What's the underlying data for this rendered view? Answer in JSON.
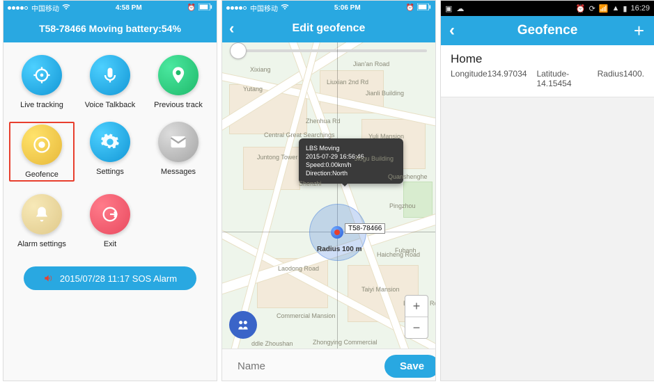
{
  "screen1": {
    "status": {
      "carrier": "中国移动",
      "time": "4:58 PM"
    },
    "title": "T58-78466 Moving battery:54%",
    "items": [
      {
        "label": "Live tracking",
        "icon": "target",
        "color": "c-blue"
      },
      {
        "label": "Voice Talkback",
        "icon": "mic",
        "color": "c-blue2"
      },
      {
        "label": "Previous track",
        "icon": "pin",
        "color": "c-green"
      },
      {
        "label": "Geofence",
        "icon": "record",
        "color": "c-yellow",
        "highlighted": true
      },
      {
        "label": "Settings",
        "icon": "gear",
        "color": "c-blue2"
      },
      {
        "label": "Messages",
        "icon": "mail",
        "color": "c-grey"
      },
      {
        "label": "Alarm settings",
        "icon": "bell",
        "color": "c-beige"
      },
      {
        "label": "Exit",
        "icon": "exit",
        "color": "c-pink"
      }
    ],
    "sos": "2015/07/28 11:17 SOS Alarm"
  },
  "screen2": {
    "status": {
      "carrier": "中国移动",
      "time": "5:06 PM"
    },
    "title": "Edit geofence",
    "tooltip": {
      "l1": "LBS Moving",
      "l2": "2015-07-29 16:56:46",
      "l3": "Speed:0.00km/h",
      "l4": "Direction:North"
    },
    "device_label": "T58-78466",
    "radius_text": "Radius 100 m",
    "map_labels": [
      "Xixiang",
      "Yutang",
      "Central Great Searchings",
      "Juntong Tower",
      "Jiogu Building",
      "Yuli Mansion",
      "Quanshenghe",
      "Pingzhou",
      "Fubanh",
      "Taiyi Mansion",
      "Zhongying Commercial",
      "Commercial Mansion",
      "ddle Zhoushan",
      "Shenzhi",
      "Jianli Building",
      "Jian'an Road",
      "Liuxian 2nd Rd",
      "Zhenhua Rd",
      "Laodong Road",
      "Haicheng Road",
      "Baoyuan Road"
    ],
    "name_placeholder": "Name",
    "save_label": "Save"
  },
  "screen3": {
    "status": {
      "time": "16:29"
    },
    "title": "Geofence",
    "entries": [
      {
        "name": "Home",
        "longitude": "Longitude134.97034",
        "latitude": "Latitude-14.15454",
        "radius": "Radius1400."
      }
    ]
  }
}
